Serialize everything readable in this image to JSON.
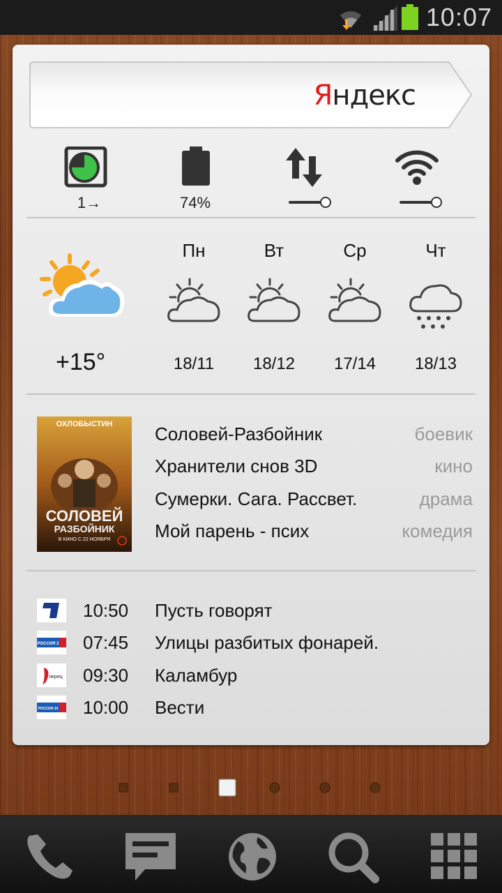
{
  "status_bar": {
    "time": "10:07",
    "icons": [
      "wifi-icon",
      "download-icon",
      "signal-icon",
      "battery-icon"
    ]
  },
  "search": {
    "brand_first": "Я",
    "brand_rest": "ндекс"
  },
  "toggles": {
    "screen_label": "1→",
    "battery_label": "74%",
    "data_level": 1.0,
    "wifi_level": 1.0
  },
  "weather": {
    "current_temp": "+15°",
    "days": [
      {
        "name": "Пн",
        "temps": "18/11",
        "icon": "partly-cloudy-icon"
      },
      {
        "name": "Вт",
        "temps": "18/12",
        "icon": "partly-cloudy-icon"
      },
      {
        "name": "Ср",
        "temps": "17/14",
        "icon": "partly-cloudy-icon"
      },
      {
        "name": "Чт",
        "temps": "18/13",
        "icon": "rain-icon"
      }
    ]
  },
  "poster": {
    "top_text": "ОХЛОБЫСТИН",
    "title_line1": "СОЛОВЕЙ",
    "title_line2": "РАЗБОЙНИК",
    "date_line": "В КИНО С 22 НОЯБРЯ"
  },
  "movies": [
    {
      "title": "Соловей-Разбойник",
      "genre": "боевик"
    },
    {
      "title": "Хранители снов 3D",
      "genre": "кино"
    },
    {
      "title": "Сумерки. Сага. Рассвет.",
      "genre": "драма"
    },
    {
      "title": "Мой парень - псих",
      "genre": "комедия"
    }
  ],
  "tv": [
    {
      "time": "10:50",
      "show": "Пусть говорят",
      "logo_text": "1"
    },
    {
      "time": "07:45",
      "show": "Улицы разбитых фонарей.",
      "logo_text": "РОССИЯ 2"
    },
    {
      "time": "09:30",
      "show": "Каламбур",
      "logo_text": "перец"
    },
    {
      "time": "10:00",
      "show": "Вести",
      "logo_text": "РОССИЯ 24"
    }
  ],
  "page_indicator": {
    "count": 7,
    "active_index": 2
  },
  "dock": [
    "phone-icon",
    "messages-icon",
    "browser-icon",
    "search-icon",
    "apps-grid-icon"
  ],
  "colors": {
    "brand_red": "#e01b1b",
    "sun_orange": "#f5a623",
    "cloud_blue": "#6fb4e6",
    "battery_green": "#7ed321"
  }
}
